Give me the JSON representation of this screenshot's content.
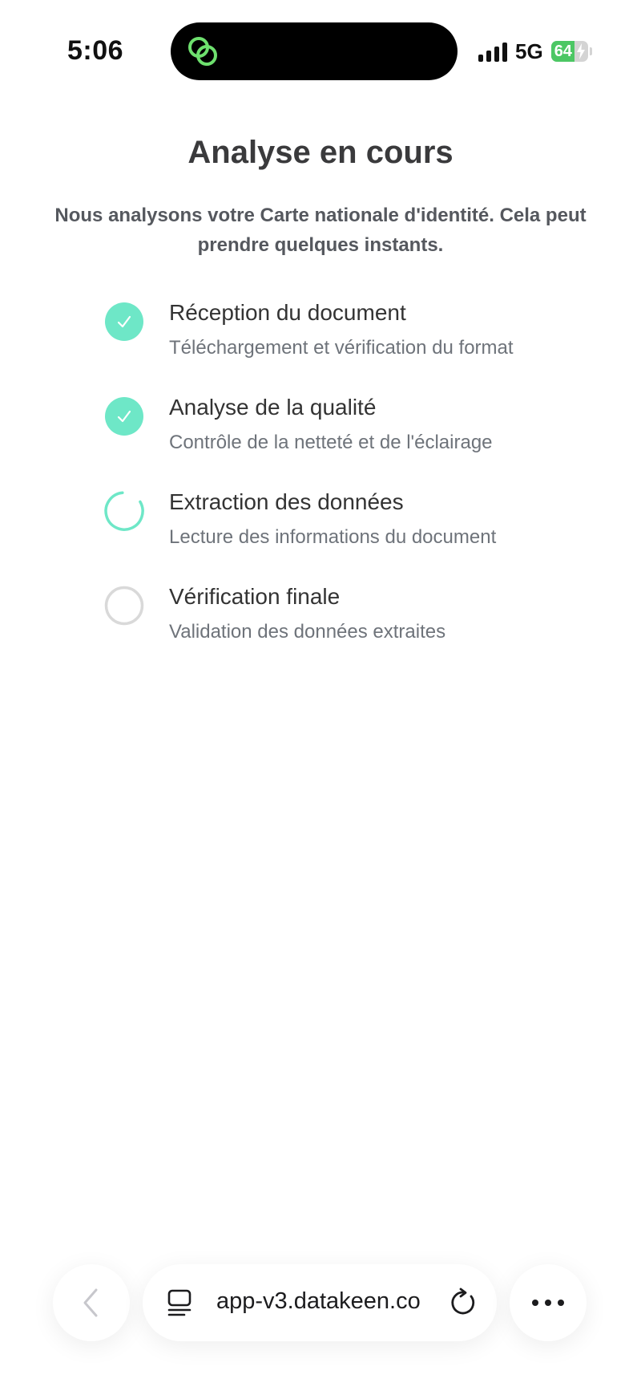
{
  "status_bar": {
    "time": "5:06",
    "network": "5G",
    "battery_percent": "64",
    "battery_level": 0.64,
    "island_icon": "link-rings-icon",
    "accent": "#6ee7b7"
  },
  "main": {
    "title": "Analyse en cours",
    "subtitle": "Nous analysons votre Carte nationale d'identité. Cela peut prendre quelques instants."
  },
  "steps": [
    {
      "title": "Réception du document",
      "description": "Téléchargement et vérification du format",
      "status": "done"
    },
    {
      "title": "Analyse de la qualité",
      "description": "Contrôle de la netteté et de l'éclairage",
      "status": "done"
    },
    {
      "title": "Extraction des données",
      "description": "Lecture des informations du document",
      "status": "in-progress"
    },
    {
      "title": "Vérification finale",
      "description": "Validation des données extraites",
      "status": "pending"
    }
  ],
  "colors": {
    "done": "#6ee7c7",
    "pending_ring": "#d9d9d9"
  },
  "browser_bar": {
    "url": "app-v3.datakeen.co",
    "back_icon": "chevron-left-icon",
    "page_icon": "page-menu-icon",
    "reload_icon": "reload-icon",
    "more_icon": "ellipsis-icon"
  }
}
